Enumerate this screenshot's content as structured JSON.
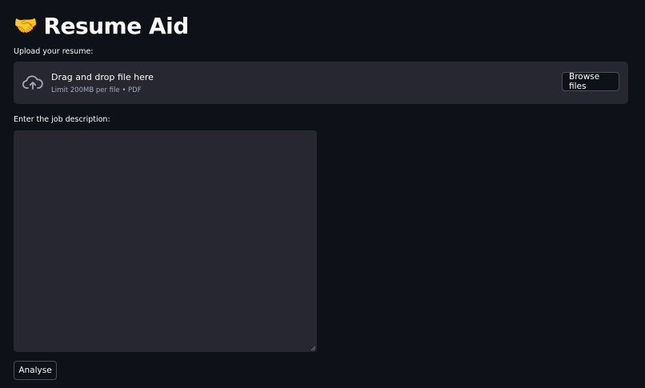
{
  "header": {
    "emoji": "🤝",
    "title": "Resume Aid"
  },
  "upload": {
    "label": "Upload your resume:",
    "dropzone_title": "Drag and drop file here",
    "dropzone_subtitle": "Limit 200MB per file • PDF",
    "browse_label": "Browse files",
    "icon": "cloud-upload-icon"
  },
  "job_description": {
    "label": "Enter the job description:",
    "value": ""
  },
  "actions": {
    "analyse_label": "Analyse"
  },
  "colors": {
    "background": "#0e1117",
    "surface": "#262730",
    "text": "#fafafa",
    "muted": "#a3a8b8",
    "border": "#4b4d57"
  }
}
